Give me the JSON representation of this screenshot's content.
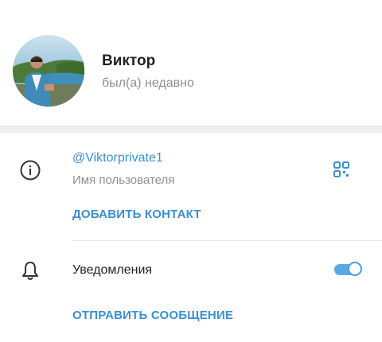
{
  "profile": {
    "name": "Виктор",
    "status": "был(а) недавно"
  },
  "info": {
    "username": "@Viktorprivate1",
    "username_label": "Имя пользователя",
    "add_contact": "ДОБАВИТЬ КОНТАКТ"
  },
  "notifications": {
    "label": "Уведомления",
    "enabled": true
  },
  "actions": {
    "send_message": "ОТПРАВИТЬ СООБЩЕНИЕ"
  },
  "colors": {
    "accent": "#3a8fd1",
    "toggle_on": "#5aa9e6",
    "secondary_text": "#8e8e8e"
  },
  "icons": {
    "info": "info-icon",
    "qr": "qr-code-icon",
    "bell": "bell-icon"
  }
}
